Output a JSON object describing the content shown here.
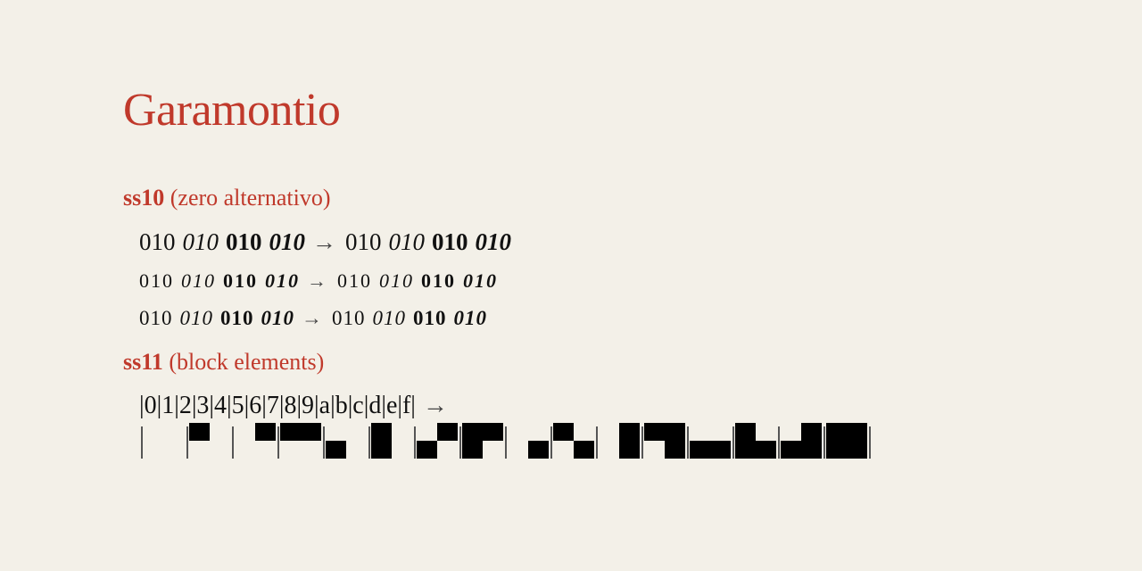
{
  "title": "Garamontio",
  "ss10": {
    "tag": "ss10",
    "desc": "(zero alternativo)",
    "rows": [
      {
        "left": [
          "010",
          "010",
          "010",
          "010"
        ],
        "arrow": "→",
        "right": [
          "010",
          "010",
          "010",
          "010"
        ]
      },
      {
        "left": [
          "010",
          "010",
          "010",
          "010"
        ],
        "arrow": "→",
        "right": [
          "010",
          "010",
          "010",
          "010"
        ]
      },
      {
        "left": [
          "010",
          "010",
          "010",
          "010"
        ],
        "arrow": "→",
        "right": [
          "010",
          "010",
          "010",
          "010"
        ]
      }
    ]
  },
  "ss11": {
    "tag": "ss11",
    "desc": "(block elements)",
    "sequence": "|0|1|2|3|4|5|6|7|8|9|a|b|c|d|e|f|",
    "arrow": "→"
  },
  "colors": {
    "accent": "#c0392b",
    "background": "#f3f0e8",
    "text": "#111111"
  }
}
